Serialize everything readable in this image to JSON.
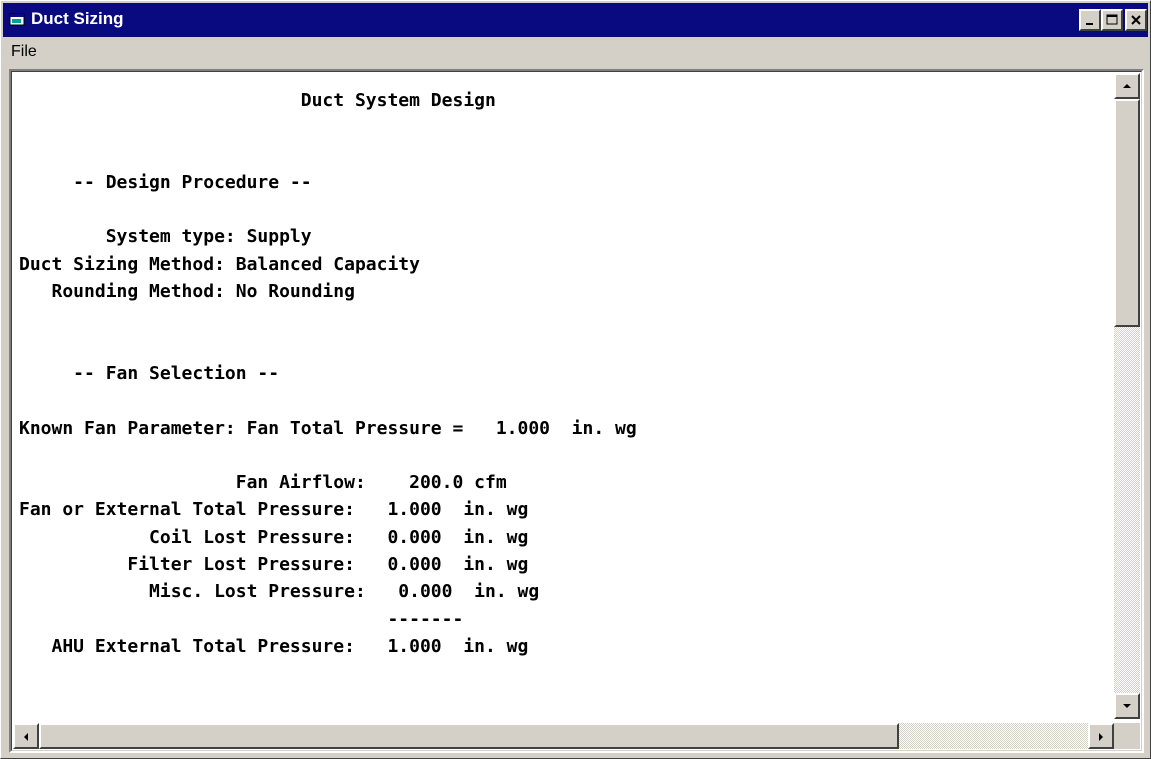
{
  "window": {
    "title": "Duct Sizing",
    "colors": {
      "titlebar": "#0a0a80",
      "face": "#d4d0c8"
    },
    "controls": [
      "minimize-icon",
      "maximize-icon",
      "close-icon"
    ]
  },
  "menubar": {
    "items": [
      {
        "label": "File"
      }
    ]
  },
  "report": {
    "lines": [
      "                          Duct System Design",
      "",
      "",
      "     -- Design Procedure --",
      "",
      "        System type: Supply",
      "Duct Sizing Method: Balanced Capacity",
      "   Rounding Method: No Rounding",
      "",
      "",
      "     -- Fan Selection --",
      "",
      "Known Fan Parameter: Fan Total Pressure =   1.000  in. wg",
      "",
      "                    Fan Airflow:    200.0 cfm",
      "Fan or External Total Pressure:   1.000  in. wg",
      "            Coil Lost Pressure:   0.000  in. wg",
      "          Filter Lost Pressure:   0.000  in. wg",
      "            Misc. Lost Pressure:   0.000  in. wg",
      "                                  -------",
      "   AHU External Total Pressure:   1.000  in. wg"
    ]
  },
  "scrollbars": {
    "vertical": {
      "icons": [
        "arrow-up-icon",
        "arrow-down-icon"
      ],
      "position": 0
    },
    "horizontal": {
      "icons": [
        "arrow-left-icon",
        "arrow-right-icon"
      ],
      "position": 0
    }
  }
}
